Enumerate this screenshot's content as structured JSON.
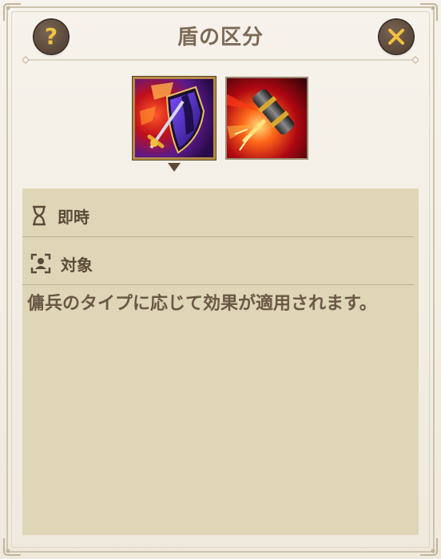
{
  "dialog": {
    "title": "盾の区分",
    "help_label": "?"
  },
  "skills": [
    {
      "icon": "shield-sword-icon",
      "selected": true
    },
    {
      "icon": "hammer-strike-icon",
      "selected": false
    }
  ],
  "details": {
    "timing_label": "即時",
    "target_label": "対象",
    "description": "傭兵のタイプに応じて効果が適用されます。"
  },
  "colors": {
    "accent_gold": "#f2c23e",
    "title_text": "#7d6a55",
    "panel_bg": "#ded6b6"
  }
}
